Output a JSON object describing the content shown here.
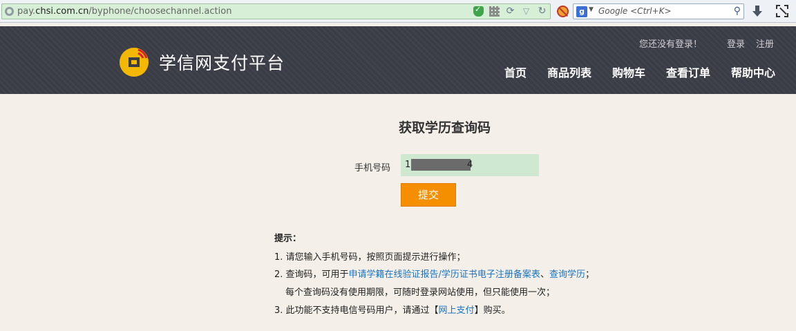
{
  "browser": {
    "url_prefix": "pay.",
    "url_host": "chsi.com.cn",
    "url_path": "/byphone/choosechannel.action",
    "search_placeholder": "Google <Ctrl+K>",
    "search_engine_letter": "g"
  },
  "header": {
    "site_name": "学信网支付平台",
    "login_status": "您还没有登录！",
    "login_label": "登录",
    "register_label": "注册",
    "nav": [
      "首页",
      "商品列表",
      "购物车",
      "查看订单",
      "帮助中心"
    ]
  },
  "main": {
    "title": "获取学历查询码",
    "phone_label": "手机号码",
    "phone_prefix": "1",
    "phone_suffix": "4",
    "submit_label": "提交"
  },
  "tips": {
    "title": "提示：",
    "line1": "1. 请您输入手机号码，按照页面提示进行操作；",
    "line2_prefix": "2. 查询码，可用于",
    "line2_link1": "申请学籍在线验证报告/学历证书电子注册备案表",
    "line2_sep": "、",
    "line2_link2": "查询学历",
    "line2_suffix": "；",
    "line2b": "每个查询码没有使用期限，可随时登录网站使用，但只能使用一次；",
    "line3_prefix": "3. 此功能不支持电信号码用户，请通过【",
    "line3_link": "网上支付",
    "line3_suffix": "】购买。"
  },
  "colors": {
    "header_bg": "#3a3c46",
    "page_bg": "#f4efe8",
    "accent": "#f58f00",
    "link": "#1a73c2",
    "logo_yellow": "#f5b800",
    "logo_red": "#d9222a"
  }
}
